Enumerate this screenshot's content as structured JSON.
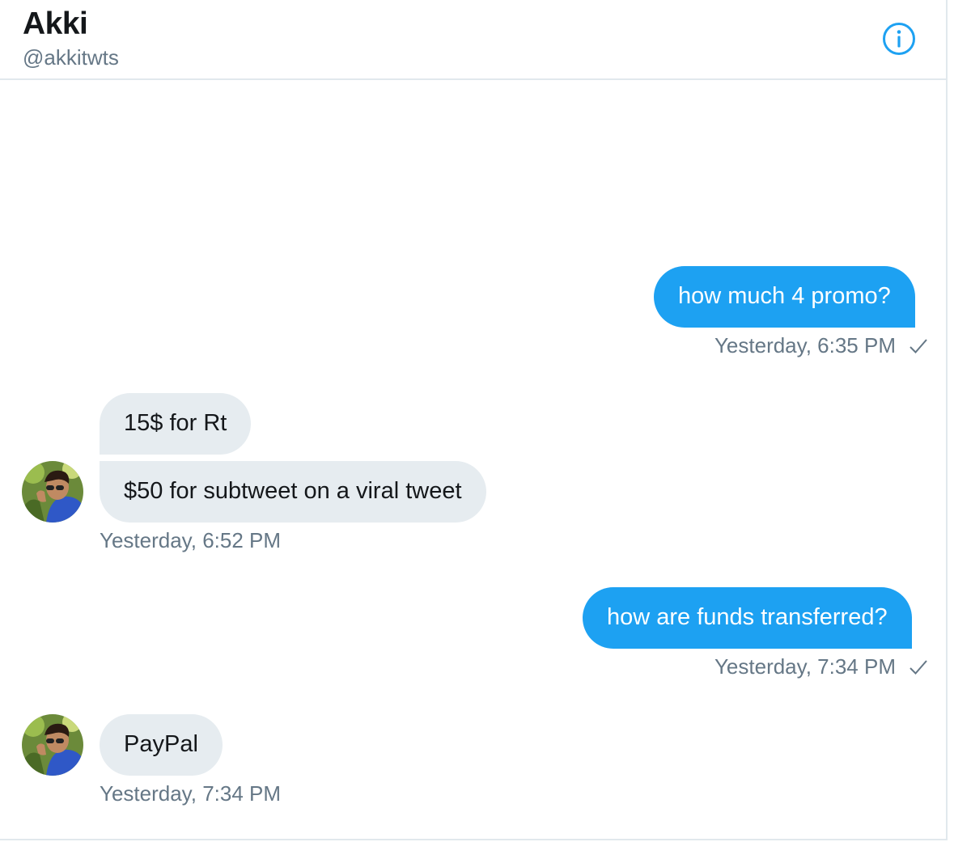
{
  "header": {
    "title": "Akki",
    "handle": "@akkitwts",
    "info_icon": "info-circle-icon"
  },
  "colors": {
    "accent": "#1da1f2",
    "incoming_bubble": "#e6ecf0",
    "secondary_text": "#657786"
  },
  "messages": [
    {
      "direction": "outgoing",
      "text": "how much 4 promo?",
      "timestamp": "Yesterday, 6:35 PM",
      "status_icon": "checkmark-icon"
    },
    {
      "direction": "incoming",
      "text": "15$ for Rt"
    },
    {
      "direction": "incoming",
      "text": "$50 for subtweet on a viral tweet",
      "timestamp": "Yesterday, 6:52 PM",
      "avatar": "avatar-icon"
    },
    {
      "direction": "outgoing",
      "text": "how are funds transferred?",
      "timestamp": "Yesterday, 7:34 PM",
      "status_icon": "checkmark-icon"
    },
    {
      "direction": "incoming",
      "text": "PayPal",
      "timestamp": "Yesterday, 7:34 PM",
      "avatar": "avatar-icon"
    }
  ]
}
